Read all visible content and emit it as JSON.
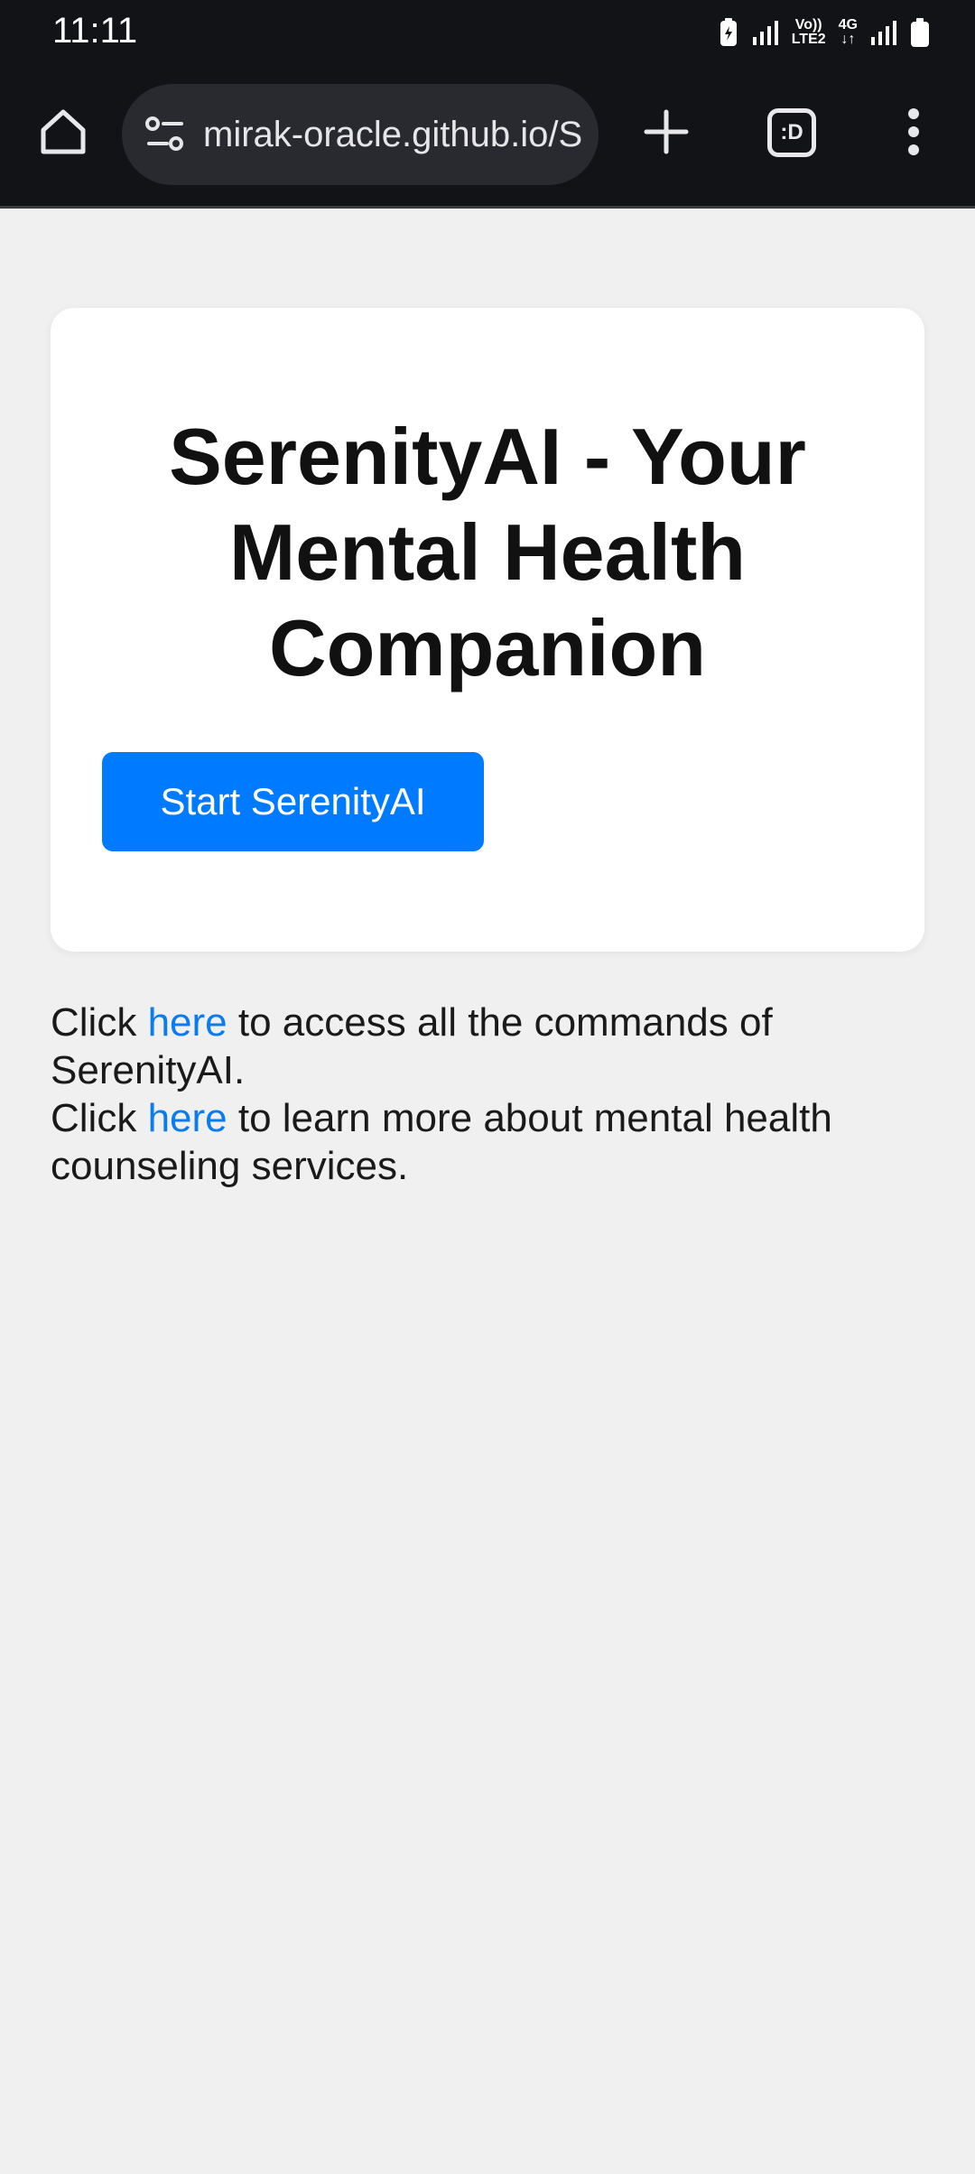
{
  "status_bar": {
    "time": "11:11",
    "network_label_top": "Vo))",
    "network_label_bottom": "LTE2",
    "network_type": "4G",
    "icons": [
      "battery-saver-icon",
      "signal-icon",
      "volte-icon",
      "4g-icon",
      "signal-icon",
      "battery-icon"
    ]
  },
  "browser": {
    "url": "mirak-oracle.github.io/SerenityAI",
    "tab_switcher_label": ":D",
    "icons": [
      "home-icon",
      "site-info-icon",
      "plus-icon",
      "tab-switcher-icon",
      "more-vert-icon"
    ]
  },
  "page": {
    "title": "SerenityAI - Your Mental Health Companion",
    "start_button_label": "Start SerenityAI",
    "line1": {
      "prefix": "Click ",
      "link": "here",
      "suffix": " to access all the commands of SerenityAI."
    },
    "line2": {
      "prefix": "Click ",
      "link": "here",
      "suffix": " to learn more about mental health counseling services."
    },
    "colors": {
      "background": "#f0f0f0",
      "button": "#007bff",
      "link": "#0a7cf0",
      "chrome": "#121317"
    }
  }
}
